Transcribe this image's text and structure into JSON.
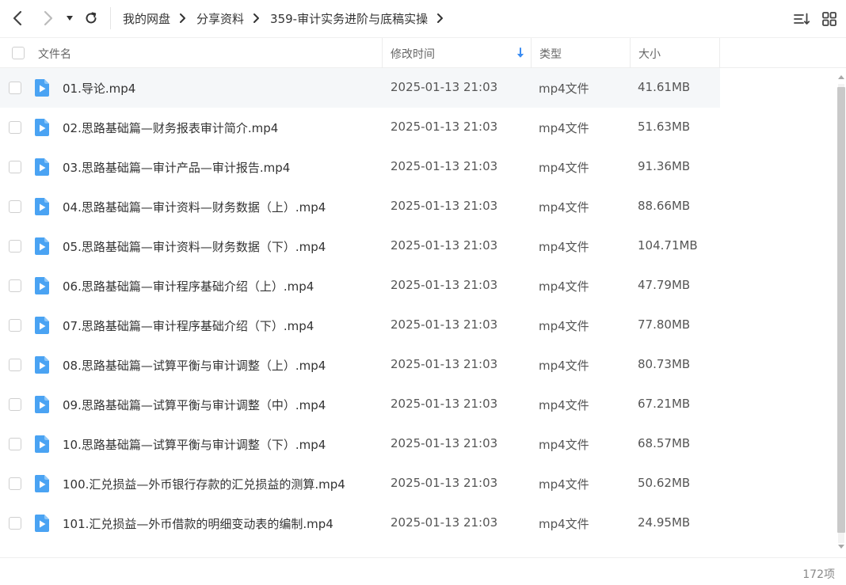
{
  "breadcrumb": [
    "我的网盘",
    "分享资料",
    "359-审计实务进阶与底稿实操"
  ],
  "columns": {
    "name": "文件名",
    "modified": "修改时间",
    "type": "类型",
    "size": "大小"
  },
  "rows": [
    {
      "name": "01.导论.mp4",
      "date": "2025-01-13 21:03",
      "type": "mp4文件",
      "size": "41.61MB"
    },
    {
      "name": "02.思路基础篇—财务报表审计简介.mp4",
      "date": "2025-01-13 21:03",
      "type": "mp4文件",
      "size": "51.63MB"
    },
    {
      "name": "03.思路基础篇—审计产品—审计报告.mp4",
      "date": "2025-01-13 21:03",
      "type": "mp4文件",
      "size": "91.36MB"
    },
    {
      "name": "04.思路基础篇—审计资料—财务数据（上）.mp4",
      "date": "2025-01-13 21:03",
      "type": "mp4文件",
      "size": "88.66MB"
    },
    {
      "name": "05.思路基础篇—审计资料—财务数据（下）.mp4",
      "date": "2025-01-13 21:03",
      "type": "mp4文件",
      "size": "104.71MB"
    },
    {
      "name": "06.思路基础篇—审计程序基础介绍（上）.mp4",
      "date": "2025-01-13 21:03",
      "type": "mp4文件",
      "size": "47.79MB"
    },
    {
      "name": "07.思路基础篇—审计程序基础介绍（下）.mp4",
      "date": "2025-01-13 21:03",
      "type": "mp4文件",
      "size": "77.80MB"
    },
    {
      "name": "08.思路基础篇—试算平衡与审计调整（上）.mp4",
      "date": "2025-01-13 21:03",
      "type": "mp4文件",
      "size": "80.73MB"
    },
    {
      "name": "09.思路基础篇—试算平衡与审计调整（中）.mp4",
      "date": "2025-01-13 21:03",
      "type": "mp4文件",
      "size": "67.21MB"
    },
    {
      "name": "10.思路基础篇—试算平衡与审计调整（下）.mp4",
      "date": "2025-01-13 21:03",
      "type": "mp4文件",
      "size": "68.57MB"
    },
    {
      "name": "100.汇兑损益—外币银行存款的汇兑损益的测算.mp4",
      "date": "2025-01-13 21:03",
      "type": "mp4文件",
      "size": "50.62MB"
    },
    {
      "name": "101.汇兑损益—外币借款的明细变动表的编制.mp4",
      "date": "2025-01-13 21:03",
      "type": "mp4文件",
      "size": "24.95MB"
    }
  ],
  "footer": {
    "count": "172项"
  },
  "colors": {
    "accent": "#3b8cf2",
    "file_icon": "#4aa3f3"
  }
}
